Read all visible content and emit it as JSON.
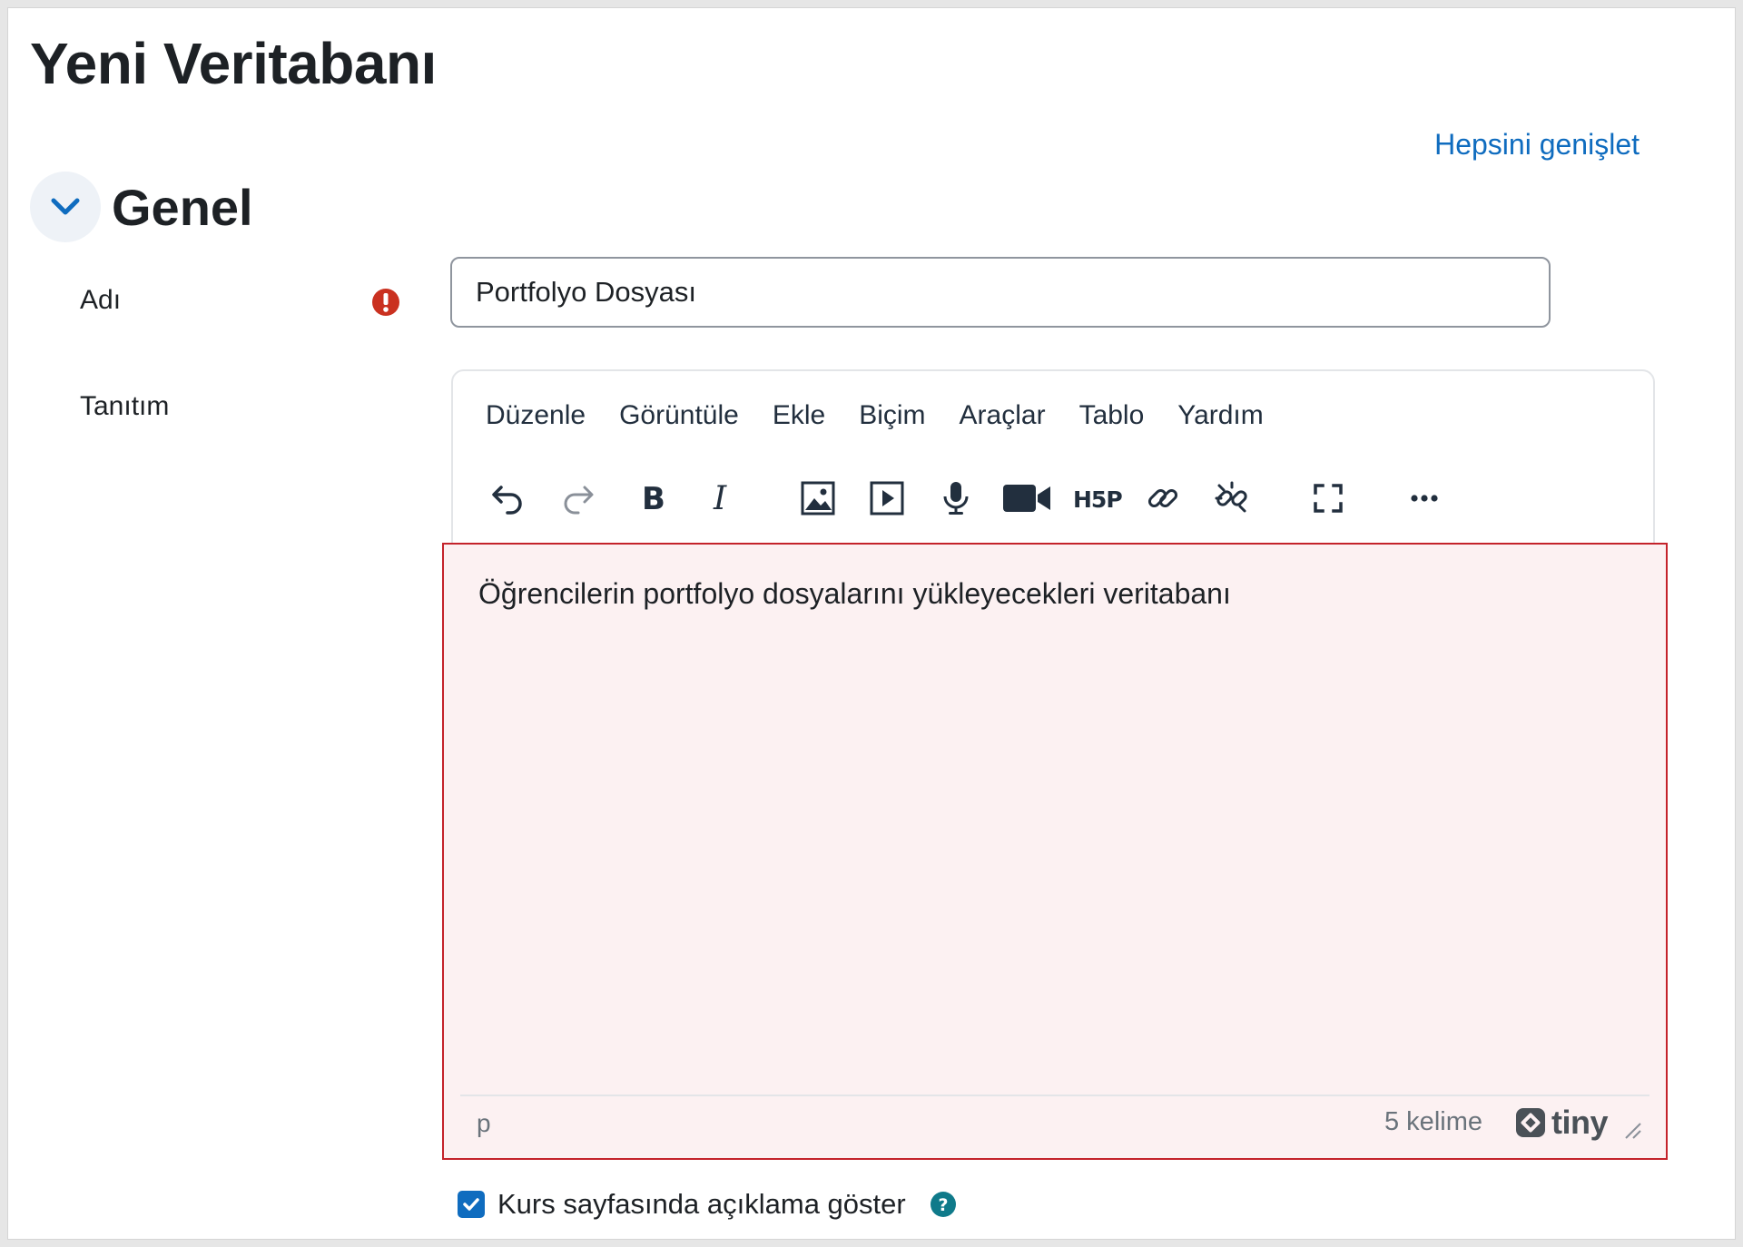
{
  "page": {
    "title": "Yeni Veritabanı",
    "expand_all_label": "Hepsini genişlet"
  },
  "section": {
    "title": "Genel",
    "toggle_icon": "chevron-down-icon"
  },
  "form": {
    "name_label": "Adı",
    "name_value": "Portfolyo Dosyası",
    "required_icon": "exclamation-circle-icon",
    "intro_label": "Tanıtım"
  },
  "editor": {
    "menu": [
      "Düzenle",
      "Görüntüle",
      "Ekle",
      "Biçim",
      "Araçlar",
      "Tablo",
      "Yardım"
    ],
    "toolbar_icons": [
      "undo-icon",
      "redo-icon",
      "bold-icon",
      "italic-icon",
      "image-icon",
      "media-icon",
      "microphone-icon",
      "video-camera-icon",
      "h5p-icon",
      "link-icon",
      "unlink-icon",
      "fullscreen-icon",
      "more-icon"
    ],
    "content": "Öğrencilerin portfolyo dosyalarını yükleyecekleri veritabanı",
    "path": "p",
    "word_count": "5 kelime",
    "brand": "tiny"
  },
  "display_option": {
    "checked": true,
    "label": "Kurs sayfasında açıklama göster",
    "help_icon": "question-circle-icon"
  },
  "colors": {
    "link": "#0f6cbf",
    "required": "#ca3120",
    "highlight_border": "#c4232b",
    "highlight_bg": "#fcf1f2",
    "help": "#0f7a8a"
  }
}
